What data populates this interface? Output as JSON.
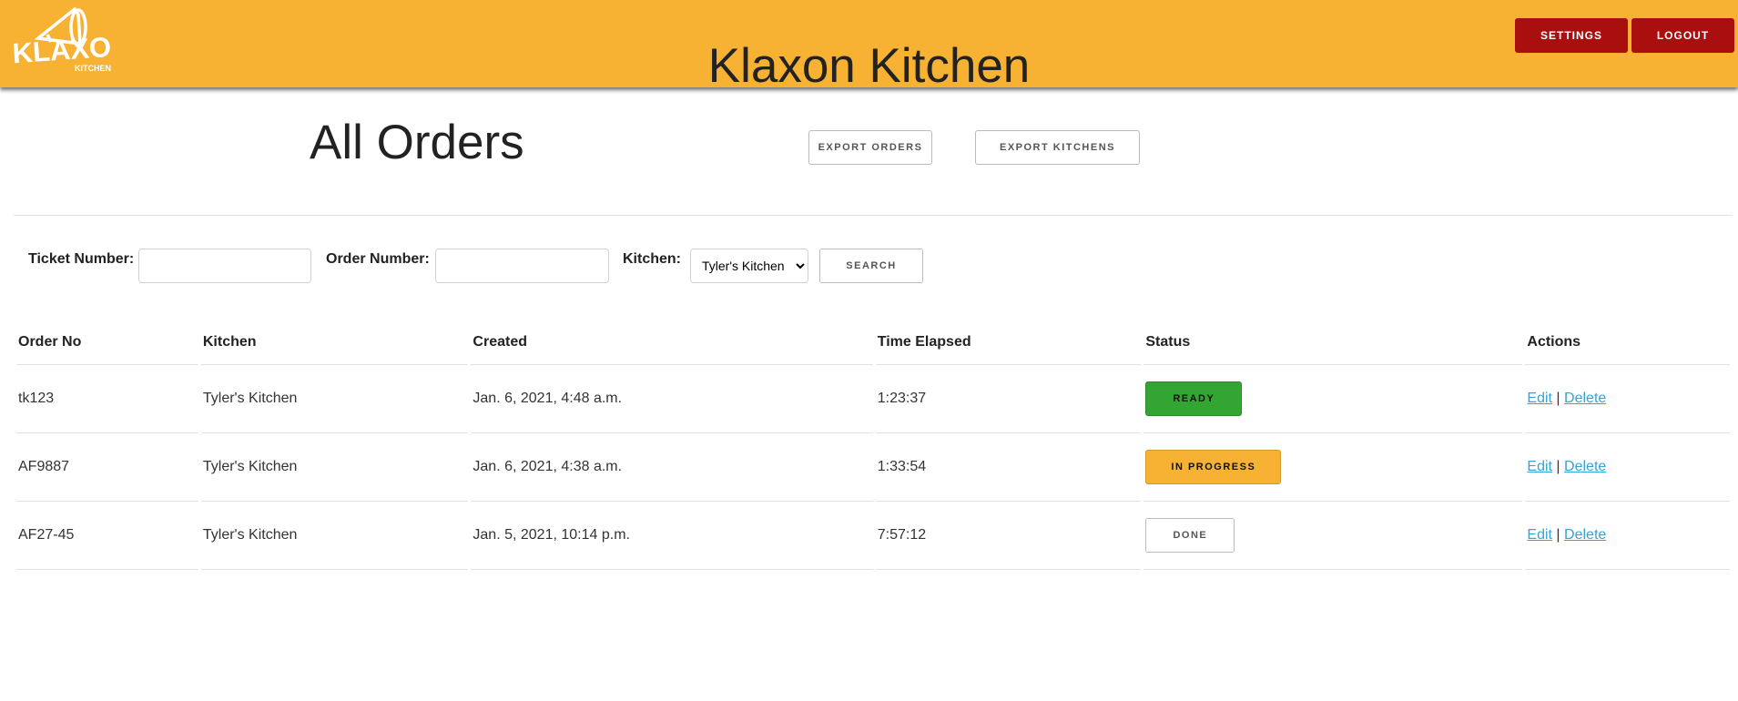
{
  "header": {
    "logo_text": "KLAXON KITCHEN",
    "title": "Klaxon Kitchen",
    "settings_label": "SETTINGS",
    "logout_label": "LOGOUT",
    "bg_color": "#f7b233",
    "button_color": "#a90f0f"
  },
  "page": {
    "title": "All Orders",
    "export_orders_label": "EXPORT ORDERS",
    "export_kitchens_label": "EXPORT KITCHENS"
  },
  "filters": {
    "ticket_label": "Ticket Number:",
    "ticket_value": "",
    "order_label": "Order Number:",
    "order_value": "",
    "kitchen_label": "Kitchen:",
    "kitchen_selected": "Tyler's Kitchen",
    "search_label": "SEARCH"
  },
  "table": {
    "headers": [
      "Order No",
      "Kitchen",
      "Created",
      "Time Elapsed",
      "Status",
      "Actions"
    ],
    "rows": [
      {
        "order_no": "tk123",
        "kitchen": "Tyler's Kitchen",
        "created": "Jan. 6, 2021, 4:48 a.m.",
        "elapsed": "1:23:37",
        "status": "READY",
        "edit": "Edit",
        "sep": "|",
        "delete": "Delete"
      },
      {
        "order_no": "AF9887",
        "kitchen": "Tyler's Kitchen",
        "created": "Jan. 6, 2021, 4:38 a.m.",
        "elapsed": "1:33:54",
        "status": "IN PROGRESS",
        "edit": "Edit",
        "sep": "|",
        "delete": "Delete"
      },
      {
        "order_no": "AF27-45",
        "kitchen": "Tyler's Kitchen",
        "created": "Jan. 5, 2021, 10:14 p.m.",
        "elapsed": "7:57:12",
        "status": "DONE",
        "edit": "Edit",
        "sep": "|",
        "delete": "Delete"
      }
    ]
  },
  "colors": {
    "ready": "#33a532",
    "in_progress": "#f7b233",
    "done": "#ffffff",
    "link": "#33a4d8"
  }
}
